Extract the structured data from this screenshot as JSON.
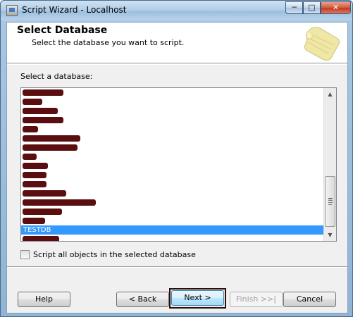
{
  "window": {
    "title": "Script Wizard - Localhost",
    "controls": {
      "minimize": "─",
      "maximize": "□",
      "close": "✕"
    }
  },
  "header": {
    "title": "Select Database",
    "subtitle": "Select the database you want to script."
  },
  "database_list": {
    "label": "Select a database:",
    "items": [
      {
        "label": "",
        "redacted": true
      },
      {
        "label": "",
        "redacted": true
      },
      {
        "label": "",
        "redacted": true
      },
      {
        "label": "",
        "redacted": true
      },
      {
        "label": "",
        "redacted": true
      },
      {
        "label": "",
        "redacted": true
      },
      {
        "label": "",
        "redacted": true
      },
      {
        "label": "",
        "redacted": true
      },
      {
        "label": "",
        "redacted": true
      },
      {
        "label": "",
        "redacted": true
      },
      {
        "label": "",
        "redacted": true
      },
      {
        "label": "",
        "redacted": true
      },
      {
        "label": "",
        "redacted": true
      },
      {
        "label": "",
        "redacted": true
      },
      {
        "label": "",
        "redacted": true
      },
      {
        "label": "TESTDB",
        "selected": true
      },
      {
        "label": "",
        "redacted": true
      }
    ],
    "selected_item": "TESTDB"
  },
  "options": {
    "script_all_label": "Script all objects in the selected database",
    "script_all_checked": false
  },
  "buttons": {
    "help": "Help",
    "back": "< Back",
    "next": "Next >",
    "finish": "Finish >>|",
    "cancel": "Cancel"
  },
  "colors": {
    "selection": "#3399ff",
    "redaction": "#5a0e10"
  }
}
